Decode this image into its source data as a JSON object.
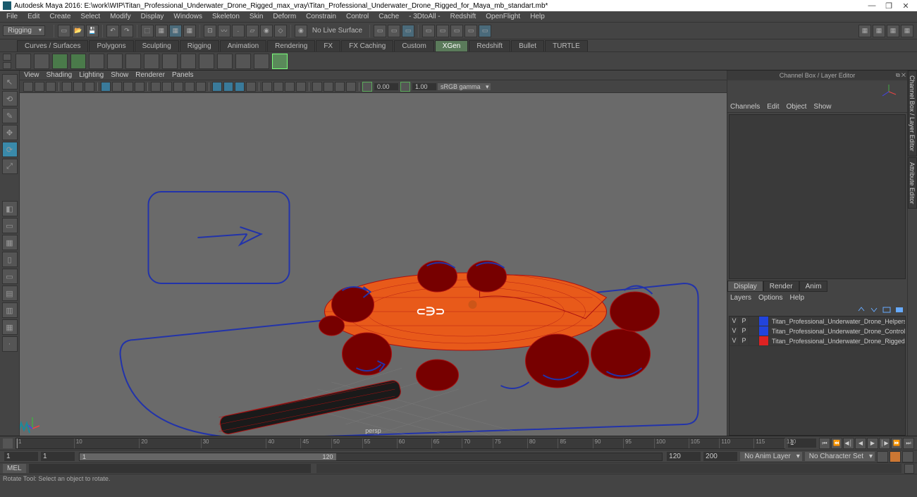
{
  "titlebar": {
    "text": "Autodesk Maya 2016: E:\\work\\WIP\\Titan_Professional_Underwater_Drone_Rigged_max_vray\\Titan_Professional_Underwater_Drone_Rigged_for_Maya_mb_standart.mb*"
  },
  "menubar": [
    "File",
    "Edit",
    "Create",
    "Select",
    "Modify",
    "Display",
    "Windows",
    "Skeleton",
    "Skin",
    "Deform",
    "Constrain",
    "Control",
    "Cache",
    "- 3DtoAll -",
    "Redshift",
    "OpenFlight",
    "Help"
  ],
  "statusline": {
    "workspace": "Rigging",
    "nolive": "No Live Surface"
  },
  "shelftabs": [
    "Curves / Surfaces",
    "Polygons",
    "Sculpting",
    "Rigging",
    "Animation",
    "Rendering",
    "FX",
    "FX Caching",
    "Custom",
    "XGen",
    "Redshift",
    "Bullet",
    "TURTLE"
  ],
  "shelftabs_active": 9,
  "viewmenu": [
    "View",
    "Shading",
    "Lighting",
    "Show",
    "Renderer",
    "Panels"
  ],
  "viewtool": {
    "exposure": "0.00",
    "gamma": "1.00",
    "colorspace": "sRGB gamma"
  },
  "viewport": {
    "camera": "persp"
  },
  "channelbox": {
    "title": "Channel Box / Layer Editor",
    "menu": [
      "Channels",
      "Edit",
      "Object",
      "Show"
    ]
  },
  "layereditor": {
    "tabs": [
      "Display",
      "Render",
      "Anim"
    ],
    "active": 0,
    "menu": [
      "Layers",
      "Options",
      "Help"
    ],
    "layers": [
      {
        "v": "V",
        "p": "P",
        "color": "#2244dd",
        "name": "Titan_Professional_Underwater_Drone_Helpers"
      },
      {
        "v": "V",
        "p": "P",
        "color": "#2244dd",
        "name": "Titan_Professional_Underwater_Drone_Controller"
      },
      {
        "v": "V",
        "p": "P",
        "color": "#dd2222",
        "name": "Titan_Professional_Underwater_Drone_Rigged"
      }
    ]
  },
  "sidetabs": [
    "Channel Box / Layer Editor",
    "Attribute Editor"
  ],
  "timeline": {
    "ticks": [
      "1",
      "10",
      "20",
      "30",
      "40",
      "45",
      "50",
      "55",
      "60",
      "65",
      "70",
      "75",
      "80",
      "85",
      "90",
      "95",
      "100",
      "105",
      "110",
      "115",
      "120"
    ],
    "current": "1"
  },
  "range": {
    "start_outer": "1",
    "start_inner": "1",
    "end_inner": "120",
    "end_outer": "120",
    "end_outer2": "200",
    "thumb_label": "120",
    "animlayer": "No Anim Layer",
    "charset": "No Character Set"
  },
  "cmdline": {
    "lang": "MEL"
  },
  "helpline": "Rotate Tool: Select an object to rotate."
}
